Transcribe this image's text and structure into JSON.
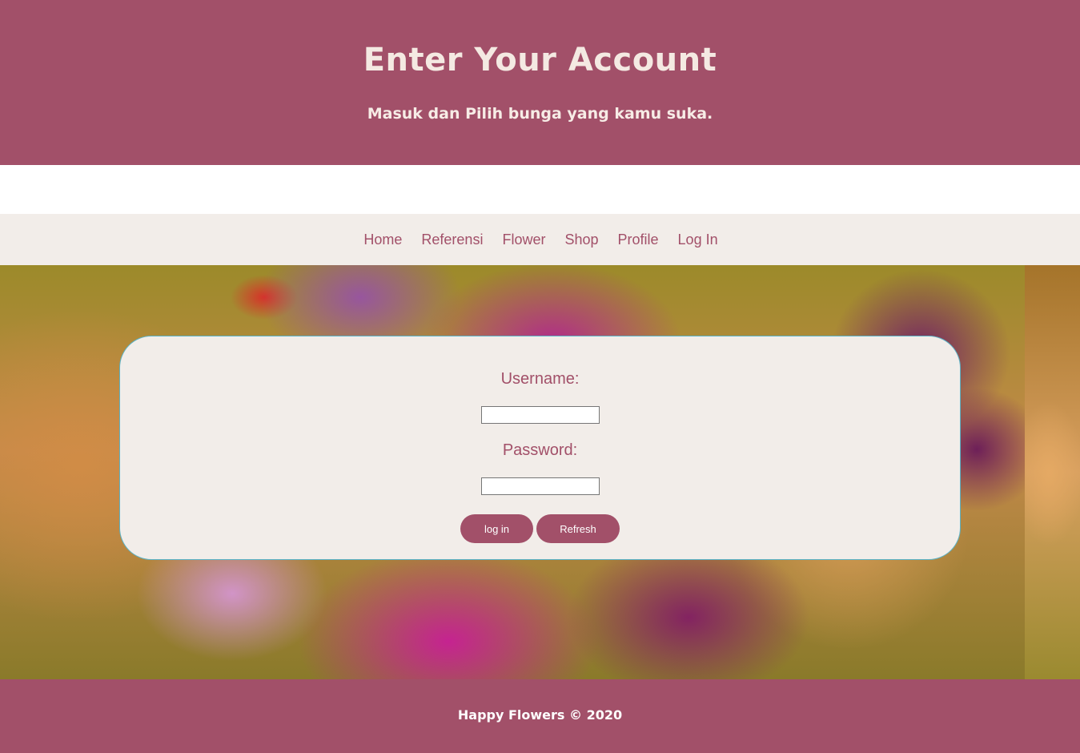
{
  "header": {
    "title": "Enter Your Account",
    "subtitle": "Masuk dan Pilih bunga yang kamu suka."
  },
  "nav": {
    "items": [
      "Home",
      "Referensi",
      "Flower",
      "Shop",
      "Profile",
      "Log In"
    ]
  },
  "login": {
    "username_label": "Username:",
    "username_value": "",
    "password_label": "Password:",
    "password_value": "",
    "login_button": "log in",
    "refresh_button": "Refresh"
  },
  "footer": {
    "text": "Happy Flowers © 2020"
  },
  "colors": {
    "brand": "#a25069",
    "panel": "#f2ede9",
    "box_border": "#5bb3c7"
  }
}
